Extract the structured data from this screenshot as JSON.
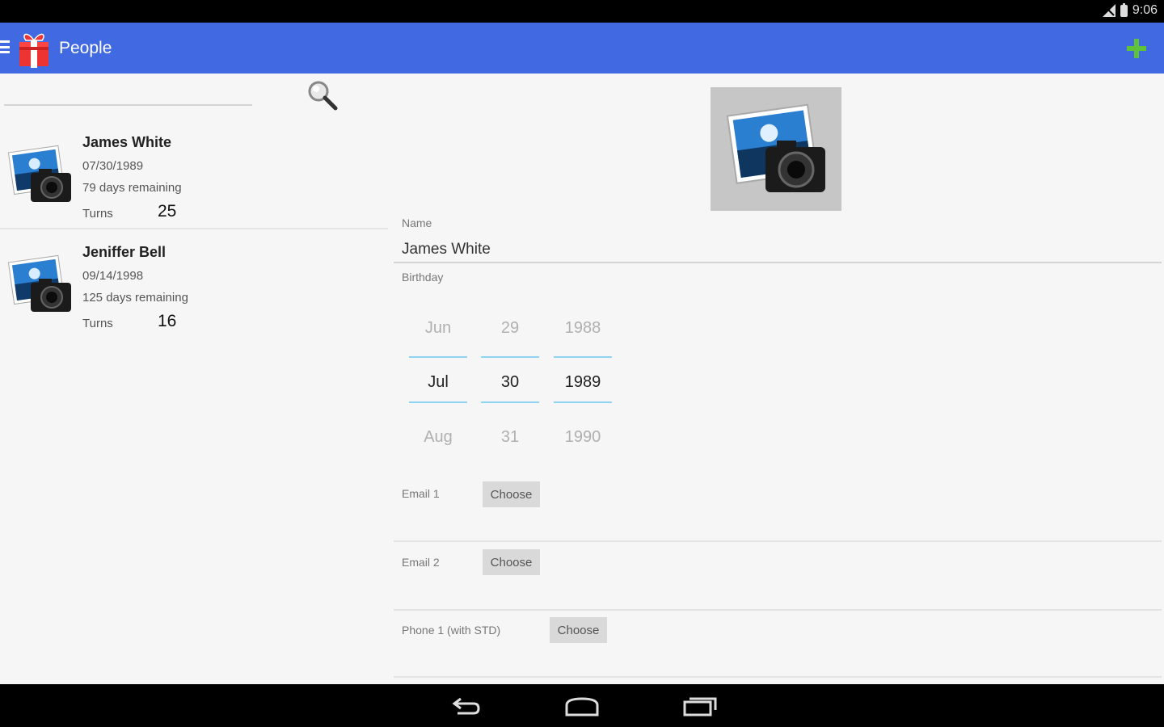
{
  "status_bar": {
    "time": "9:06"
  },
  "action_bar": {
    "title": "People"
  },
  "search": {
    "placeholder": ""
  },
  "people": [
    {
      "name": "James White",
      "birthdate": "07/30/1989",
      "remaining": "79 days remaining",
      "turns_label": "Turns",
      "turns": "25"
    },
    {
      "name": "Jeniffer Bell",
      "birthdate": "09/14/1998",
      "remaining": "125 days remaining",
      "turns_label": "Turns",
      "turns": "16"
    }
  ],
  "detail": {
    "name_label": "Name",
    "name_value": "James White",
    "birthday_label": "Birthday",
    "picker": {
      "month": {
        "prev": "Jun",
        "current": "Jul",
        "next": "Aug"
      },
      "day": {
        "prev": "29",
        "current": "30",
        "next": "31"
      },
      "year": {
        "prev": "1988",
        "current": "1989",
        "next": "1990"
      }
    },
    "email1_label": "Email 1",
    "email2_label": "Email 2",
    "phone1_label": "Phone 1 (with STD)",
    "choose_label": "Choose"
  },
  "colors": {
    "action_bar": "#4169e1",
    "add": "#5ec33b",
    "picker_line": "#8fd3f0"
  }
}
